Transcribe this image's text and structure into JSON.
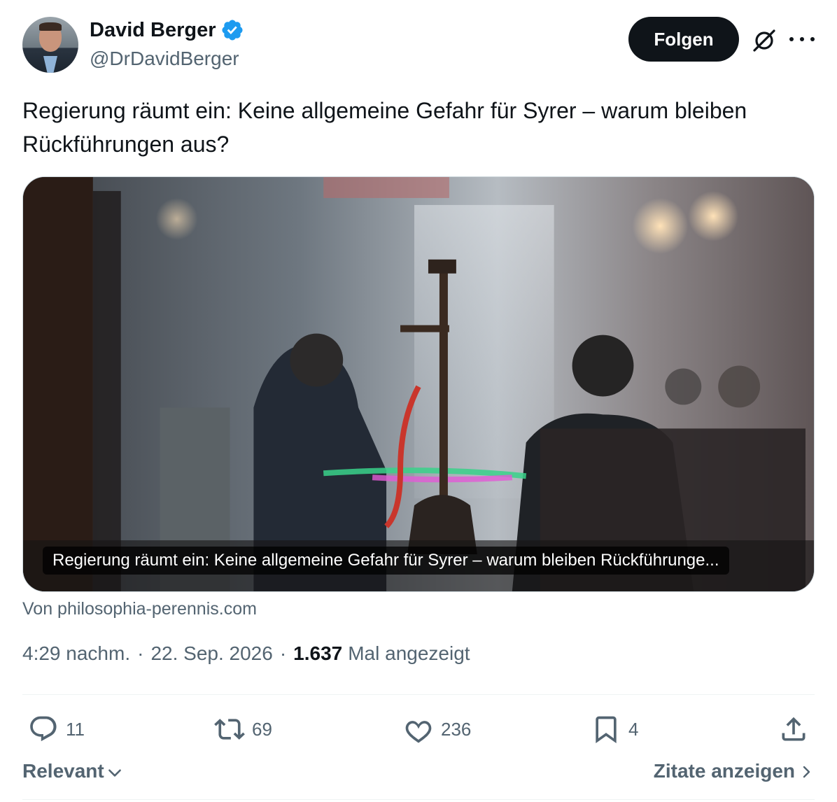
{
  "author": {
    "display_name": "David Berger",
    "handle": "@DrDavidBerger",
    "verified": true
  },
  "header": {
    "follow_label": "Folgen"
  },
  "tweet": {
    "text": "Regierung räumt ein: Keine allgemeine Gefahr für Syrer – warum bleiben Rückführungen aus?"
  },
  "card": {
    "caption": "Regierung räumt ein: Keine allgemeine Gefahr für Syrer – warum bleiben Rückführunge...",
    "source": "Von philosophia-perennis.com"
  },
  "meta": {
    "time": "4:29 nachm.",
    "separator": "·",
    "date": "22. Sep. 2026",
    "views_count": "1.637",
    "views_label": "Mal angezeigt"
  },
  "actions": {
    "replies": "11",
    "reposts": "69",
    "likes": "236",
    "bookmarks": "4"
  },
  "footer": {
    "sort_label": "Relevant",
    "quotes_label": "Zitate anzeigen"
  },
  "colors": {
    "verified": "#1d9bf0",
    "text_primary": "#0f1419",
    "text_secondary": "#536471"
  },
  "icons": [
    "verified-badge-icon",
    "grok-icon",
    "more-icon",
    "reply-icon",
    "repost-icon",
    "like-icon",
    "bookmark-icon",
    "share-icon",
    "chevron-down-icon",
    "chevron-right-icon"
  ]
}
